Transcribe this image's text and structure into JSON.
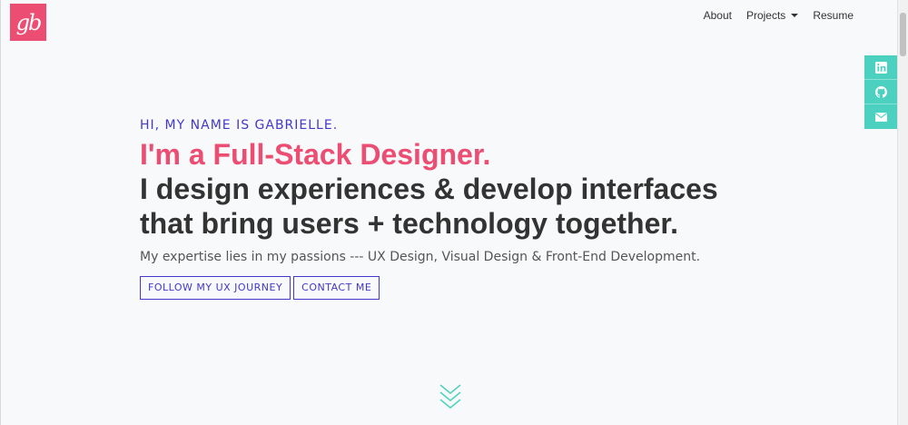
{
  "brand": {
    "logo_text": "gb",
    "color": "#ec4d72"
  },
  "nav": {
    "items": [
      {
        "label": "About"
      },
      {
        "label": "Projects",
        "dropdown": true
      },
      {
        "label": "Resume"
      }
    ]
  },
  "social": {
    "color": "#4cd1c1",
    "items": [
      {
        "icon": "linkedin-icon"
      },
      {
        "icon": "github-icon"
      },
      {
        "icon": "envelope-icon"
      }
    ]
  },
  "hero": {
    "greeting": "HI, MY NAME IS GABRIELLE.",
    "role": "I'm a Full-Stack Designer.",
    "headline_line1": "I design experiences & develop interfaces",
    "headline_line2": "that bring users + technology together.",
    "subtext": "My expertise lies in my passions --- UX Design, Visual Design & Front-End Development.",
    "buttons": [
      {
        "label": "FOLLOW MY UX JOURNEY"
      },
      {
        "label": "CONTACT ME"
      }
    ],
    "accent_color": "#4338ca",
    "role_color": "#ec4d72"
  },
  "scroll_indicator": {
    "icon": "chevrons-down-icon",
    "color": "#4cd1c1"
  }
}
